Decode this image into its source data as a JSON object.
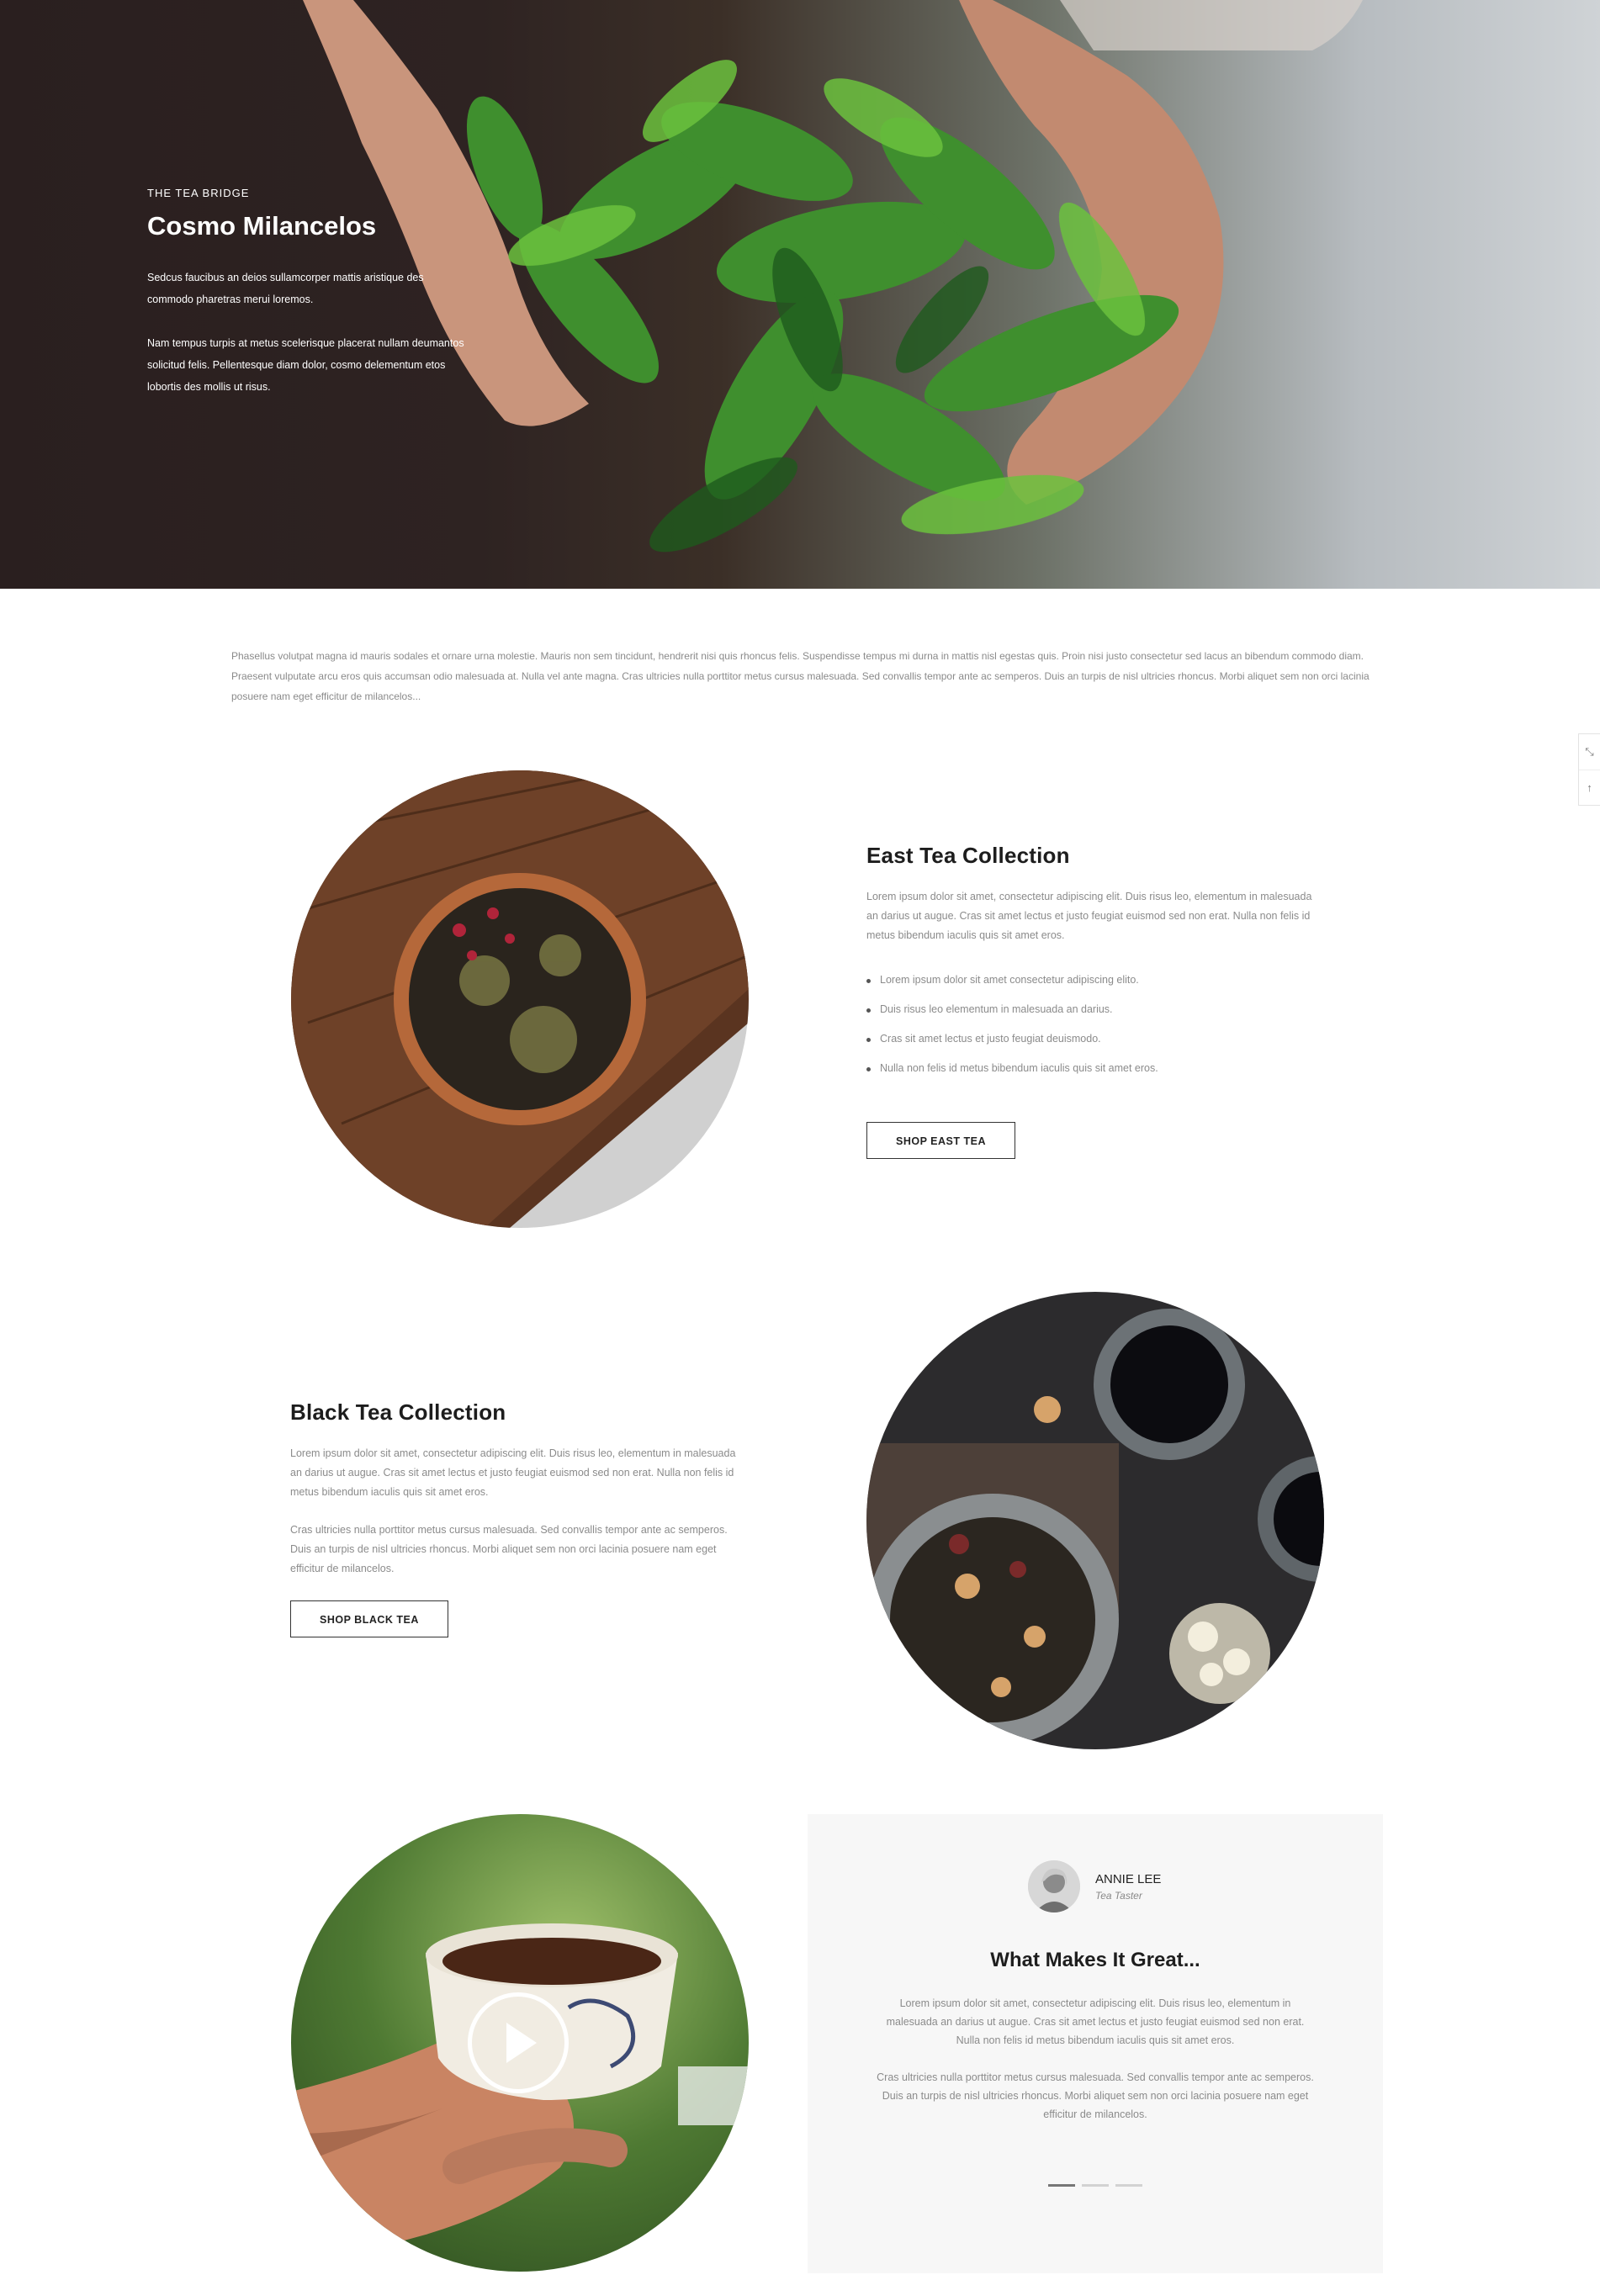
{
  "hero": {
    "eyebrow": "THE TEA BRIDGE",
    "title": "Cosmo Milancelos",
    "paragraph_1": "Sedcus faucibus an deios sullamcorper mattis aristique des commodo pharetras merui loremos.",
    "paragraph_2": "Nam tempus turpis at metus scelerisque placerat nullam deumantos solicitud felis. Pellentesque diam dolor, cosmo delementum etos lobortis des mollis ut risus."
  },
  "intro": "Phasellus volutpat magna id mauris sodales et ornare urna molestie. Mauris non sem tincidunt, hendrerit nisi quis rhoncus felis. Suspendisse tempus mi durna in mattis nisl egestas quis. Proin nisi justo consectetur sed lacus an bibendum commodo diam. Praesent vulputate arcu eros quis accumsan odio malesuada at. Nulla vel ante magna. Cras ultricies nulla porttitor metus cursus malesuada. Sed convallis tempor ante ac semperos. Duis an turpis de nisl ultricies rhoncus. Morbi aliquet sem non orci lacinia posuere nam eget efficitur de milancelos...",
  "east": {
    "title": "East Tea Collection",
    "paragraph": "Lorem ipsum dolor sit amet, consectetur adipiscing elit. Duis risus leo, elementum in malesuada an darius ut augue. Cras sit amet lectus et justo feugiat euismod sed non erat. Nulla non felis id metus bibendum iaculis quis sit amet eros.",
    "bullets": [
      "Lorem ipsum dolor sit amet consectetur adipiscing elito.",
      "Duis risus leo elementum in malesuada an darius.",
      "Cras sit amet lectus et justo feugiat deuismodo.",
      "Nulla non felis id metus bibendum iaculis quis sit amet eros."
    ],
    "button": "SHOP EAST TEA"
  },
  "black": {
    "title": "Black Tea Collection",
    "paragraph_1": "Lorem ipsum dolor sit amet, consectetur adipiscing elit. Duis risus leo, elementum in malesuada an darius ut augue. Cras sit amet lectus et justo feugiat euismod sed non erat. Nulla non felis id metus bibendum iaculis quis sit amet eros.",
    "paragraph_2": "Cras ultricies nulla porttitor metus cursus malesuada. Sed convallis tempor ante ac semperos. Duis an turpis de nisl ultricies rhoncus. Morbi aliquet sem non orci lacinia posuere nam eget efficitur de milancelos.",
    "button": "SHOP BLACK TEA"
  },
  "testimonial": {
    "name": "ANNIE LEE",
    "role": "Tea Taster",
    "title": "What Makes It Great...",
    "paragraph_1": "Lorem ipsum dolor sit amet, consectetur adipiscing elit. Duis risus leo, elementum in malesuada an darius ut augue. Cras sit amet lectus et justo feugiat euismod sed non erat. Nulla non felis id metus bibendum iaculis quis sit amet eros.",
    "paragraph_2": "Cras ultricies nulla porttitor metus cursus malesuada. Sed convallis tempor ante ac semperos. Duis an turpis de nisl ultricies rhoncus. Morbi aliquet sem non orci lacinia posuere nam eget efficitur de milancelos.",
    "slides": 3,
    "active_slide": 1
  },
  "icons": {
    "side_tool_1": "expand-icon",
    "side_tool_2": "scroll-top-icon",
    "video": "play-icon"
  }
}
